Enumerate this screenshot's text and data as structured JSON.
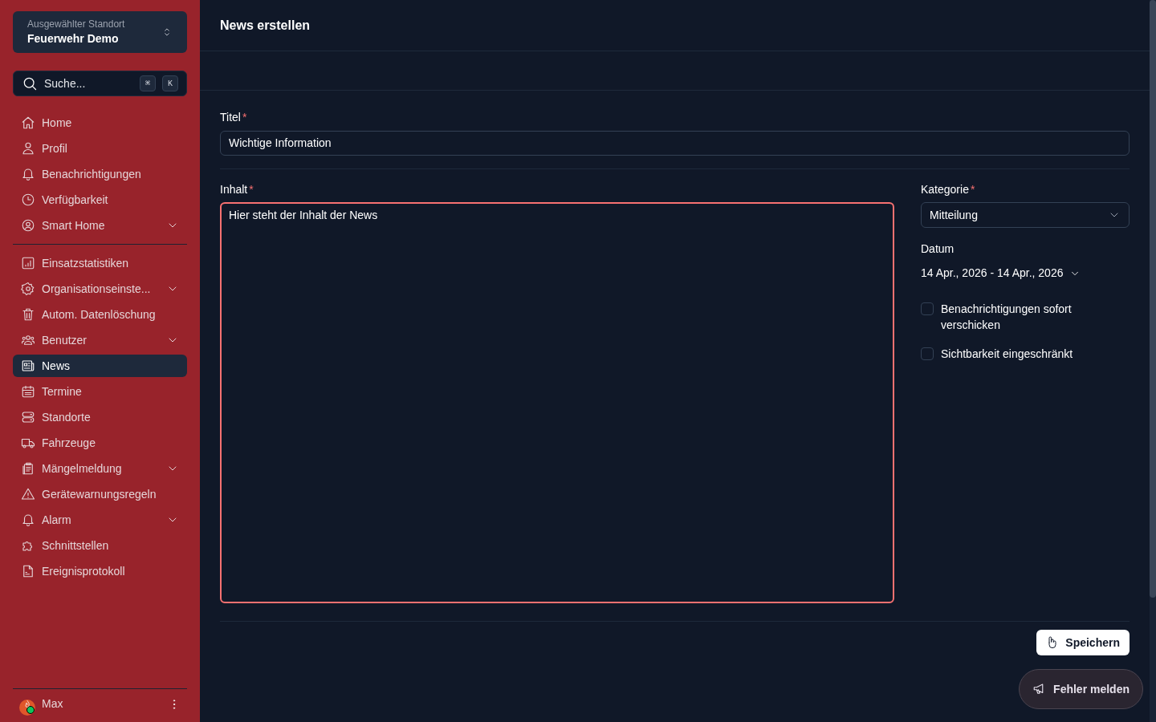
{
  "location_switcher": {
    "label": "Ausgewählter Standort",
    "value": "Feuerwehr Demo"
  },
  "search": {
    "placeholder": "Suche...",
    "keys": [
      "⌘",
      "K"
    ]
  },
  "sidebar": {
    "groups": [
      {
        "items": [
          {
            "label": "Home",
            "expandable": false,
            "selected": false
          },
          {
            "label": "Profil",
            "expandable": false,
            "selected": false
          },
          {
            "label": "Benachrichtigungen",
            "expandable": false,
            "selected": false
          },
          {
            "label": "Verfügbarkeit",
            "expandable": false,
            "selected": false
          },
          {
            "label": "Smart Home",
            "expandable": true,
            "selected": false
          }
        ]
      },
      {
        "items": [
          {
            "label": "Einsatzstatistiken",
            "expandable": false,
            "selected": false
          },
          {
            "label": "Organisationseinste...",
            "expandable": true,
            "selected": false
          },
          {
            "label": "Autom. Datenlöschung",
            "expandable": false,
            "selected": false
          },
          {
            "label": "Benutzer",
            "expandable": true,
            "selected": false
          },
          {
            "label": "News",
            "expandable": false,
            "selected": true
          },
          {
            "label": "Termine",
            "expandable": false,
            "selected": false
          },
          {
            "label": "Standorte",
            "expandable": false,
            "selected": false
          },
          {
            "label": "Fahrzeuge",
            "expandable": false,
            "selected": false
          },
          {
            "label": "Mängelmeldung",
            "expandable": true,
            "selected": false
          },
          {
            "label": "Gerätewarnungsregeln",
            "expandable": false,
            "selected": false
          },
          {
            "label": "Alarm",
            "expandable": true,
            "selected": false
          },
          {
            "label": "Schnittstellen",
            "expandable": false,
            "selected": false
          },
          {
            "label": "Ereignisprotokoll",
            "expandable": false,
            "selected": false
          }
        ]
      }
    ]
  },
  "user": {
    "name": "Max",
    "online": true
  },
  "page": {
    "title": "News erstellen"
  },
  "form": {
    "title_field": {
      "label": "Titel",
      "required_mark": "*",
      "value": "Wichtige Information"
    },
    "content_field": {
      "label": "Inhalt",
      "required_mark": "*",
      "value": "Hier steht der Inhalt der News",
      "error": true
    },
    "category_field": {
      "label": "Kategorie",
      "required_mark": "*",
      "value": "Mitteilung"
    },
    "date_field": {
      "label": "Datum",
      "value": "14 Apr., 2026 - 14 Apr., 2026"
    },
    "checkboxes": [
      {
        "label": "Benachrichtigungen sofort verschicken",
        "checked": false
      },
      {
        "label": "Sichtbarkeit eingeschränkt",
        "checked": false
      }
    ],
    "save_button": "Speichern"
  },
  "report_button": "Fehler melden"
}
